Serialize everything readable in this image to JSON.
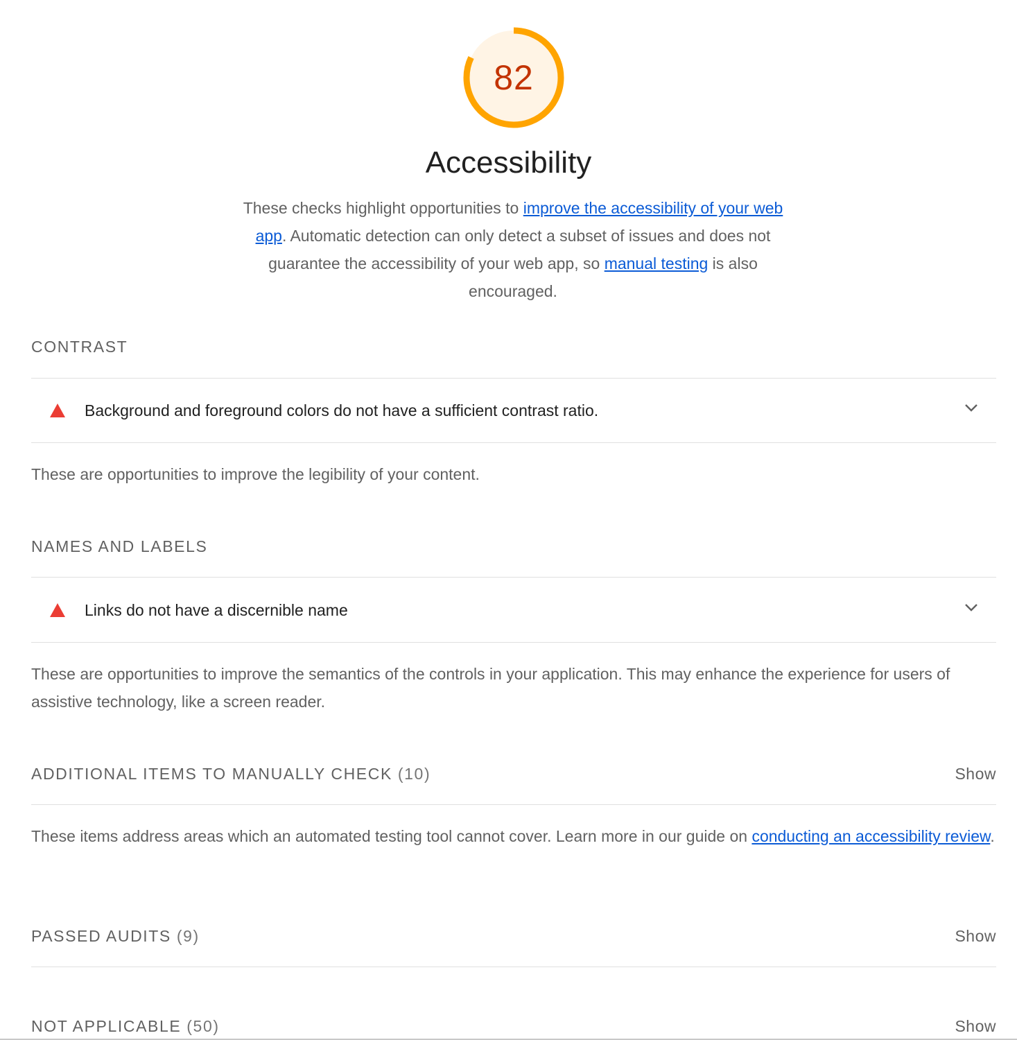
{
  "category": {
    "score": "82",
    "score_fraction": 0.82,
    "title": "Accessibility",
    "gauge_colors": {
      "arc": "#ffa400",
      "fill": "#fff4e5",
      "text": "#c33300"
    },
    "description": {
      "part1": "These checks highlight opportunities to ",
      "link1": "improve the accessibility of your web app",
      "part2": ". Automatic detection can only detect a subset of issues and does not guarantee the accessibility of your web app, so ",
      "link2": "manual testing",
      "part3": " is also encouraged."
    }
  },
  "groups": {
    "contrast": {
      "title": "Contrast",
      "audit": "Background and foreground colors do not have a sufficient contrast ratio.",
      "description": "These are opportunities to improve the legibility of your content."
    },
    "names_labels": {
      "title": "Names and labels",
      "audit": "Links do not have a discernible name",
      "description": "These are opportunities to improve the semantics of the controls in your application. This may enhance the experience for users of assistive technology, like a screen reader."
    },
    "manual": {
      "title": "Additional items to manually check",
      "count": "(10)",
      "show": "Show",
      "description_text": "These items address areas which an automated testing tool cannot cover. Learn more in our guide on ",
      "description_link": "conducting an accessibility review",
      "description_end": "."
    },
    "passed": {
      "title": "Passed audits",
      "count": "(9)",
      "show": "Show"
    },
    "not_applicable": {
      "title": "Not applicable",
      "count": "(50)",
      "show": "Show"
    }
  },
  "colors": {
    "fail": "#eb3d34",
    "link": "#0b5bd6"
  }
}
